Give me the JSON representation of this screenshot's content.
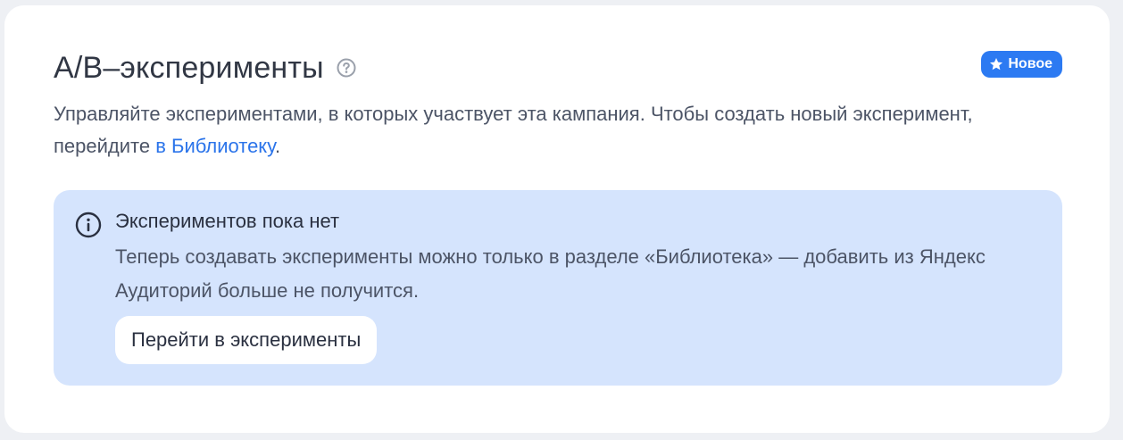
{
  "section": {
    "title": "А/В–эксперименты",
    "help_icon": "question-circle-icon",
    "badge": {
      "label": "Новое",
      "icon": "star-icon",
      "color": "#2c7af2"
    },
    "description": {
      "text_before_link": "Управляйте экспериментами, в которых участвует эта кампания. Чтобы создать новый эксперимент, перейдите ",
      "link_text": "в Библиотеку",
      "text_after_link": "."
    }
  },
  "notice": {
    "icon": "info-circle-icon",
    "title": "Экспериментов пока нет",
    "text": "Теперь создавать эксперименты можно только в разделе «Библиотека» — добавить из Яндекс Аудиторий больше не получится.",
    "button_label": "Перейти в эксперименты",
    "background": "#d5e4fd"
  }
}
